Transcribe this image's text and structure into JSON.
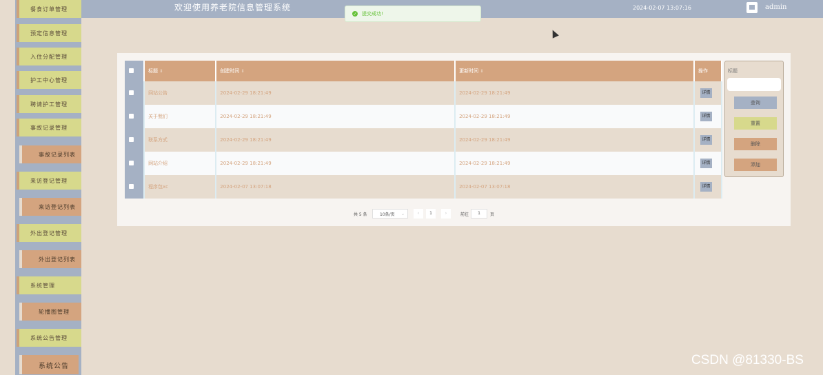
{
  "header": {
    "title": "欢迎使用养老院信息管理系统",
    "time": "2024-02-07 13:07:16",
    "user": "admin"
  },
  "toast": {
    "text": "提交成功!"
  },
  "sidebar": {
    "items": [
      {
        "label": "餐食订单管理"
      },
      {
        "label": "预定信息管理"
      },
      {
        "label": "入住分配管理"
      },
      {
        "label": "护工中心管理"
      },
      {
        "label": "聘请护工管理"
      },
      {
        "label": "事故记录管理"
      },
      {
        "label": "事故记录列表"
      },
      {
        "label": "来访登记管理"
      },
      {
        "label": "来访登记列表"
      },
      {
        "label": "外出登记管理"
      },
      {
        "label": "外出登记列表"
      },
      {
        "label": "系统管理"
      },
      {
        "label": "轮播图管理"
      },
      {
        "label": "系统公告管理"
      },
      {
        "label": "系统公告"
      }
    ]
  },
  "table": {
    "headers": {
      "title": "标题",
      "created": "创建时间",
      "updated": "更新时间",
      "ops": "操作"
    },
    "detail_label": "详情",
    "rows": [
      {
        "title": "网站公告",
        "created": "2024-02-29 18:21:49",
        "updated": "2024-02-29 18:21:49"
      },
      {
        "title": "关于我们",
        "created": "2024-02-29 18:21:49",
        "updated": "2024-02-29 18:21:49"
      },
      {
        "title": "联系方式",
        "created": "2024-02-29 18:21:49",
        "updated": "2024-02-29 18:21:49"
      },
      {
        "title": "网站介绍",
        "created": "2024-02-29 18:21:49",
        "updated": "2024-02-29 18:21:49"
      },
      {
        "title": "程序包xc",
        "created": "2024-02-07 13:07:18",
        "updated": "2024-02-07 13:07:18"
      }
    ]
  },
  "search": {
    "label": "标题",
    "query_btn": "查询",
    "reset_btn": "重置",
    "delete_btn": "删除",
    "add_btn": "添加",
    "colors": {
      "query": "#a5b1c4",
      "reset": "#d7d98c",
      "delete": "#d4a47f",
      "add": "#d4a47f"
    }
  },
  "pager": {
    "total": "共 5 条",
    "page_size": "10条/页",
    "current": "1",
    "goto_label": "前往",
    "goto_value": "1",
    "page_unit": "页"
  },
  "watermark": "CSDN @81330-BS"
}
